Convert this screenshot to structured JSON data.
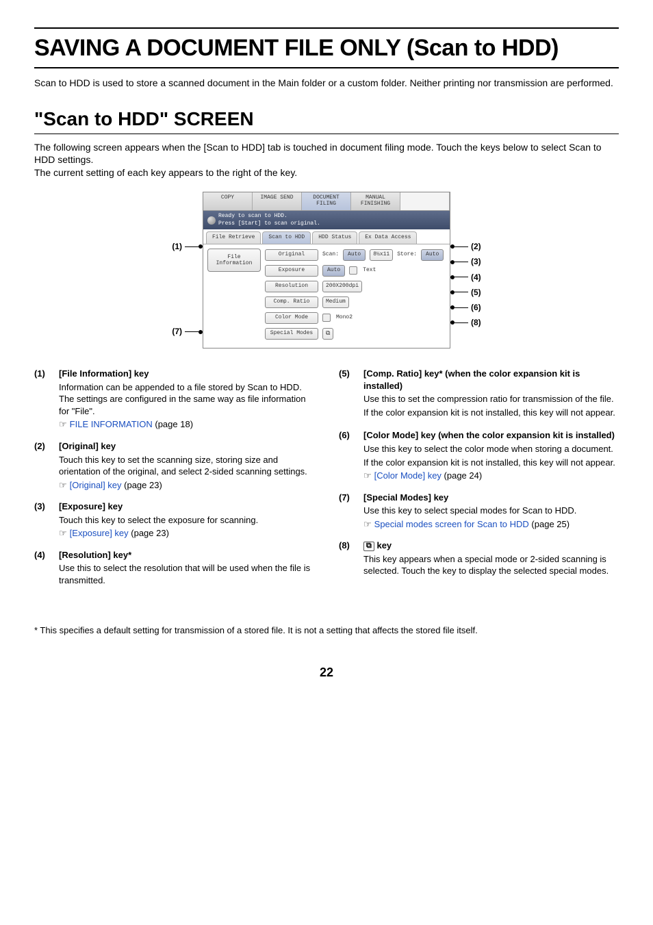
{
  "h1": "SAVING A DOCUMENT FILE ONLY (Scan to HDD)",
  "intro": "Scan to HDD is used to store a scanned document in the Main folder or a custom folder. Neither printing nor transmission are performed.",
  "h2": "\"Scan to HDD\" SCREEN",
  "sub_intro_1": "The following screen appears when the [Scan to HDD] tab is touched in document filing mode. Touch the keys below to select Scan to HDD settings.",
  "sub_intro_2": "The current setting of each key appears to the right of the key.",
  "screen": {
    "tabs": [
      "COPY",
      "IMAGE SEND",
      "DOCUMENT FILING",
      "MANUAL FINISHING",
      ""
    ],
    "status_1": "Ready to scan to HDD.",
    "status_2": "Press [Start] to scan original.",
    "subtabs": [
      "File Retrieve",
      "Scan to HDD",
      "HDD Status",
      "Ex Data Access"
    ],
    "file_info_btn": "File Information",
    "rows": {
      "original": {
        "k": "Original",
        "lbl": "Scan:",
        "pill": "Auto",
        "box": "8½x11",
        "lbl2": "Store:",
        "pill2": "Auto"
      },
      "exposure": {
        "k": "Exposure",
        "pill": "Auto",
        "lbl": "Text"
      },
      "resolution": {
        "k": "Resolution",
        "val": "200X200dpi"
      },
      "comp": {
        "k": "Comp. Ratio",
        "val": "Medium"
      },
      "color": {
        "k": "Color Mode",
        "val": "Mono2"
      },
      "special": {
        "k": "Special Modes"
      }
    }
  },
  "callouts_left": {
    "1": "(1)",
    "7": "(7)"
  },
  "callouts_right": {
    "2": "(2)",
    "3": "(3)",
    "4": "(4)",
    "5": "(5)",
    "6": "(6)",
    "8": "(8)"
  },
  "left_items": [
    {
      "num": "(1)",
      "title": "[File Information] key",
      "para": "Information can be appended to a file stored by Scan to HDD. The settings are configured in the same way as file information for \"File\".",
      "ref": "FILE INFORMATION",
      "ref_page": " (page 18)"
    },
    {
      "num": "(2)",
      "title": "[Original] key",
      "para": "Touch this key to set the scanning size, storing size and orientation of the original, and select 2-sided scanning settings.",
      "ref": "[Original] key",
      "ref_page": " (page 23)"
    },
    {
      "num": "(3)",
      "title": "[Exposure] key",
      "para": "Touch this key to select the exposure for scanning.",
      "ref": "[Exposure] key",
      "ref_page": " (page 23)"
    },
    {
      "num": "(4)",
      "title": "[Resolution] key*",
      "para": "Use this to select the resolution that will be used when the file is transmitted."
    }
  ],
  "right_items": [
    {
      "num": "(5)",
      "title": "[Comp. Ratio] key* (when the color expansion kit is installed)",
      "para": "Use this to set the compression ratio for transmission of the file.",
      "para2": "If the color expansion kit is not installed, this key will not appear."
    },
    {
      "num": "(6)",
      "title": "[Color Mode] key (when the color expansion kit is installed)",
      "para": "Use this key to select the color mode when storing a document.",
      "para2": "If the color expansion kit is not installed, this key will not appear.",
      "ref": "[Color Mode] key",
      "ref_page": " (page 24)"
    },
    {
      "num": "(7)",
      "title": "[Special Modes] key",
      "para": "Use this key to select special modes for Scan to HDD.",
      "ref": "Special modes screen for Scan to HDD",
      "ref_page": " (page 25)"
    },
    {
      "num": "(8)",
      "title_prefix": "",
      "title_suffix": " key",
      "para": "This key appears when a special mode or 2-sided scanning is selected. Touch the key to display the selected special modes."
    }
  ],
  "footnote": "* This specifies a default setting for transmission of a stored file. It is not a setting that affects the stored file itself.",
  "page_num": "22"
}
